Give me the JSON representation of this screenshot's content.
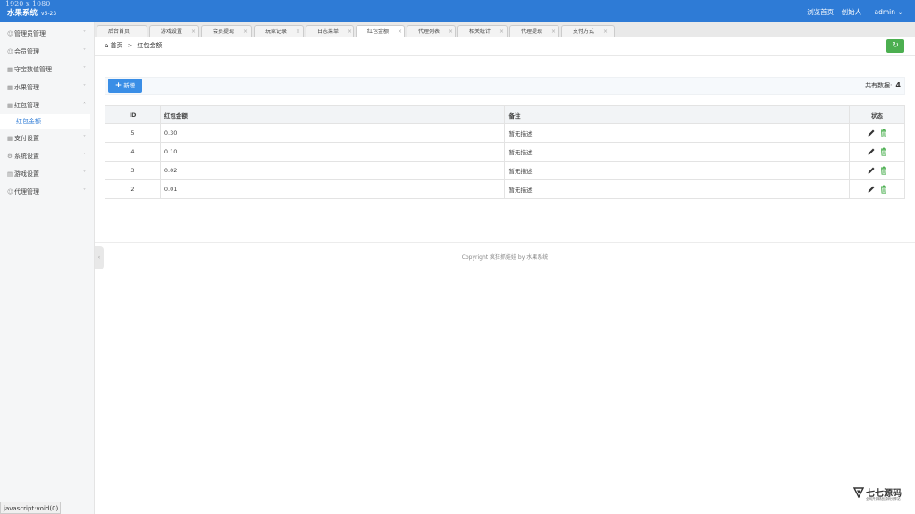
{
  "header": {
    "resolution": "1920 x 1080",
    "app_name": "水果系统",
    "version": "v5-23",
    "browse_home": "浏览首页",
    "creator": "创始人",
    "user": "admin"
  },
  "sidebar": {
    "items": [
      {
        "label": "管理员管理",
        "icon": "user-icon"
      },
      {
        "label": "会员管理",
        "icon": "user-icon"
      },
      {
        "label": "守宝数值管理",
        "icon": "grid-icon"
      },
      {
        "label": "水果管理",
        "icon": "grid-icon"
      },
      {
        "label": "红包管理",
        "icon": "grid-icon"
      },
      {
        "label": "支付设置",
        "icon": "grid-icon"
      },
      {
        "label": "系统设置",
        "icon": "gear-icon"
      },
      {
        "label": "游戏设置",
        "icon": "gamepad-icon"
      },
      {
        "label": "代理管理",
        "icon": "user-icon"
      }
    ],
    "active_sub": "红包金额",
    "status_text": "javascript:void(0)"
  },
  "tabs": [
    {
      "label": "后台首页"
    },
    {
      "label": "游戏设置"
    },
    {
      "label": "会员提现"
    },
    {
      "label": "玩家记录"
    },
    {
      "label": "日志菜单"
    },
    {
      "label": "红包金额"
    },
    {
      "label": "代理列表"
    },
    {
      "label": "相关统计"
    },
    {
      "label": "代理提现"
    },
    {
      "label": "支付方式"
    }
  ],
  "breadcrumb": {
    "home": "首页",
    "current": "红包金额"
  },
  "toolbar": {
    "add_label": "新增",
    "count_label": "共有数据:",
    "count_value": "4"
  },
  "table": {
    "headers": {
      "id": "ID",
      "amount": "红包金额",
      "note": "备注",
      "status": "状态"
    },
    "rows": [
      {
        "id": "5",
        "amount": "0.30",
        "note": "暂无描述"
      },
      {
        "id": "4",
        "amount": "0.10",
        "note": "暂无描述"
      },
      {
        "id": "3",
        "amount": "0.02",
        "note": "暂无描述"
      },
      {
        "id": "2",
        "amount": "0.01",
        "note": "暂无描述"
      }
    ]
  },
  "footer": {
    "copyright": "Copyright 疯狂抓娃娃 by 水果系统"
  },
  "watermark": {
    "title": "七七源码",
    "subtitle": "全网开源精品源码分享站"
  },
  "colors": {
    "primary": "#2e7bd6",
    "success": "#4caf50",
    "edit": "#333333",
    "delete": "#4caf50"
  }
}
